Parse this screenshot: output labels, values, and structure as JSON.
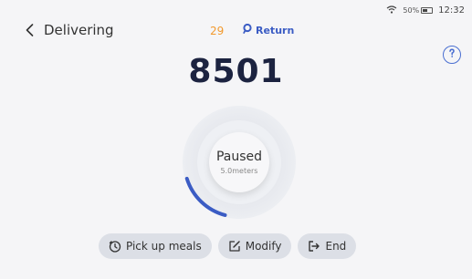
{
  "status_bar": {
    "battery": "50%",
    "battery_level": 0.5,
    "time": "12:32"
  },
  "header": {
    "title": "Delivering",
    "back_icon": "chevron-left-icon"
  },
  "count": "29",
  "return_button": {
    "label": "Return",
    "icon": "location-pin-icon"
  },
  "help_button": {
    "icon": "help-icon"
  },
  "order_number": "8501",
  "dial": {
    "status": "Paused",
    "distance": "5.0meters",
    "progress": 0.16,
    "accent": "#3b5cc4"
  },
  "actions": [
    {
      "label": "Pick up meals",
      "icon": "clock-icon"
    },
    {
      "label": "Modify",
      "icon": "edit-icon"
    },
    {
      "label": "End",
      "icon": "exit-icon"
    }
  ],
  "colors": {
    "count": "#f29a2e",
    "accent": "#3b5cc4",
    "title": "#1c2340",
    "button_bg": "#dcdfe6"
  }
}
